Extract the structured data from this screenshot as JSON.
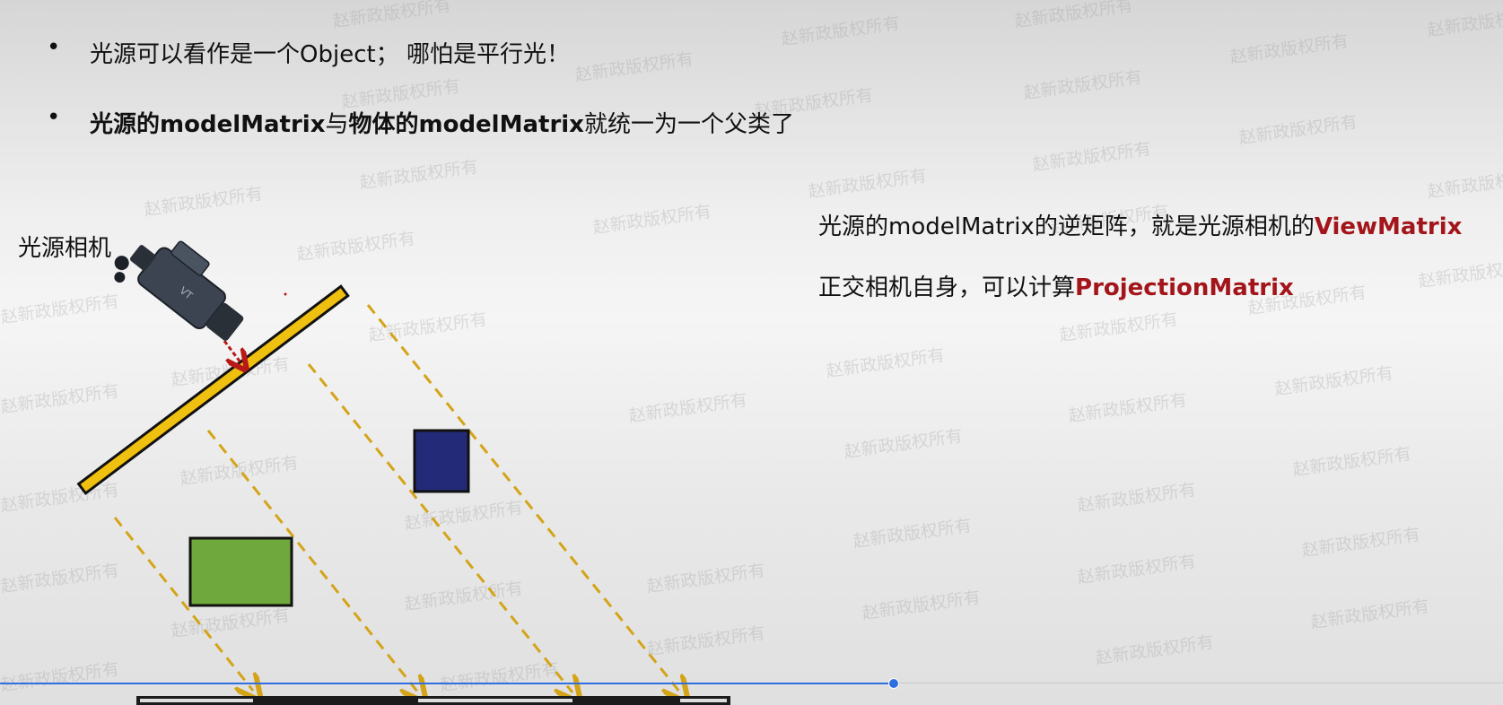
{
  "bullets": [
    {
      "dot": "•",
      "text": "光源可以看作是一个Object；  哪怕是平行光！"
    },
    {
      "dot": "•",
      "bold_part_1": "光源的modelMatrix",
      "normal_part_1": "与",
      "bold_part_2": "物体的modelMatrix",
      "normal_part_2": "就统一为一个父类了"
    }
  ],
  "camera_label": "光源相机",
  "notes": [
    {
      "prefix": "光源的modelMatrix的逆矩阵，就是光源相机的",
      "highlight": "ViewMatrix"
    },
    {
      "prefix": "正交相机自身，可以计算",
      "highlight": "ProjectionMatrix"
    }
  ],
  "watermark_text": "赵新政版权所有",
  "colors": {
    "highlight": "#a3151a",
    "light_plane": "#f0c010",
    "ray": "#d4a418",
    "blue_box": "#232a78",
    "green_box": "#6fa83c",
    "arrow": "#b81818",
    "progress": "#2f6fe0"
  },
  "icons": {
    "camera": "video-camera-icon"
  }
}
